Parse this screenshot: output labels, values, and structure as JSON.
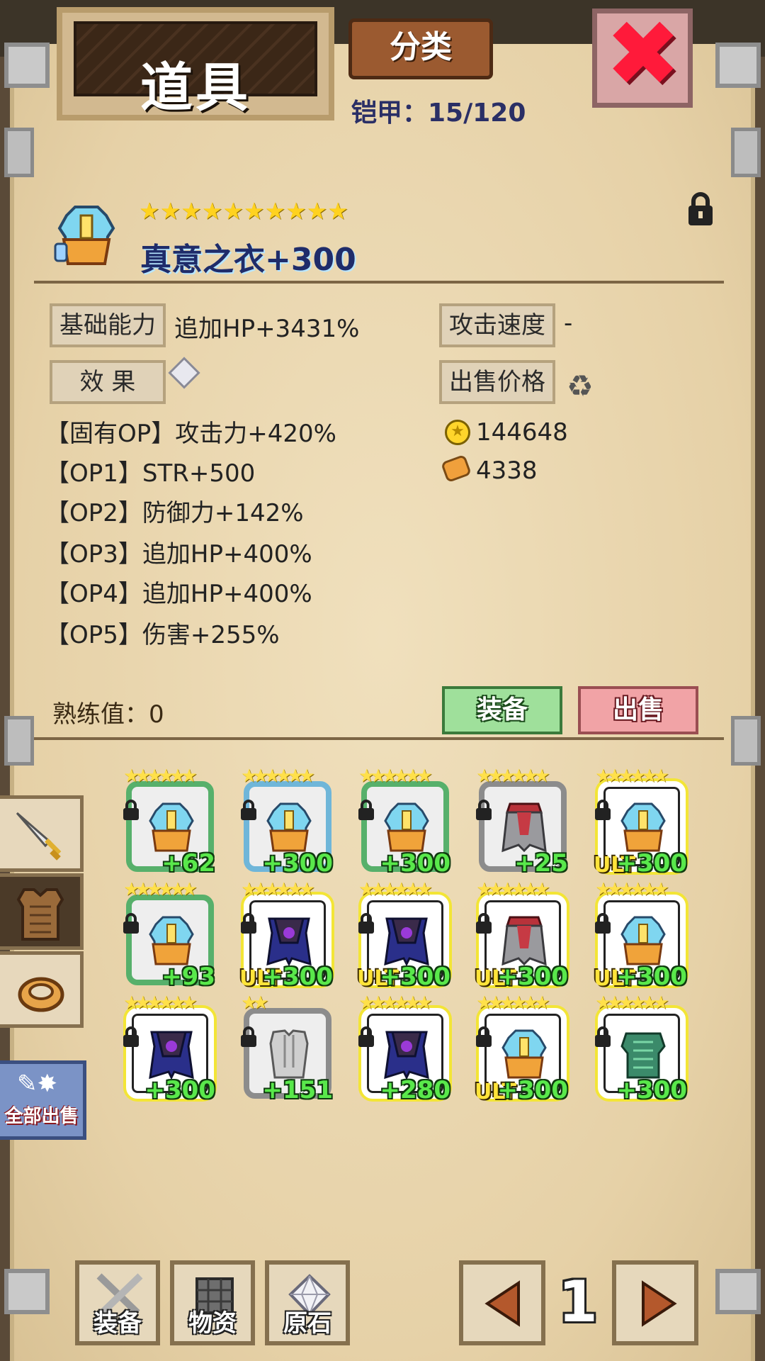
{
  "header": {
    "title": "道具",
    "category_label": "分类",
    "armor_counter": "铠甲：15/120",
    "close_icon": "close-x-icon"
  },
  "item": {
    "stars": "★★★★★★★★★★",
    "name": "真意之衣+300",
    "lock_icon": "lock-icon",
    "base_label": "基础能力",
    "base_value": "追加HP+3431%",
    "effect_label": "效 果",
    "speed_label": "攻击速度",
    "speed_value": "-",
    "price_label": "出售价格",
    "gold_price": "144648",
    "ore_price": "4338",
    "options": [
      "【固有OP】攻击力+420%",
      "【OP1】STR+500",
      "【OP2】防御力+142%",
      "【OP3】追加HP+400%",
      "【OP4】追加HP+400%",
      "【OP5】伤害+255%"
    ],
    "proficiency": "熟练值：0",
    "equip_label": "装备",
    "sell_label": "出售"
  },
  "side_tabs": {
    "weapon_icon": "sword-icon",
    "armor_icon": "armor-icon",
    "ring_icon": "ring-icon",
    "sell_all_label": "全部出售"
  },
  "inventory": [
    {
      "level": "+62",
      "ult": "",
      "stars": "★★★★★★",
      "art": "robe"
    },
    {
      "level": "+300",
      "ult": "",
      "stars": "★★★★★★",
      "art": "robe"
    },
    {
      "level": "+300",
      "ult": "",
      "stars": "★★★★★★",
      "art": "robe"
    },
    {
      "level": "+25",
      "ult": "",
      "stars": "★★★★★★",
      "art": "cape"
    },
    {
      "level": "+300",
      "ult": "ULT",
      "stars": "★★★★★★",
      "art": "robe"
    },
    {
      "level": "+93",
      "ult": "",
      "stars": "★★★★★★",
      "art": "robe"
    },
    {
      "level": "+300",
      "ult": "ULT",
      "stars": "★★★★★★",
      "art": "dark"
    },
    {
      "level": "+300",
      "ult": "ULT",
      "stars": "★★★★★★",
      "art": "dark"
    },
    {
      "level": "+300",
      "ult": "ULT",
      "stars": "★★★★★★",
      "art": "cape"
    },
    {
      "level": "+300",
      "ult": "ULT",
      "stars": "★★★★★★",
      "art": "robe"
    },
    {
      "level": "+300",
      "ult": "",
      "stars": "★★★★★★",
      "art": "dark"
    },
    {
      "level": "+151",
      "ult": "",
      "stars": "★★",
      "art": "iron"
    },
    {
      "level": "+280",
      "ult": "",
      "stars": "★★★★★★",
      "art": "dark"
    },
    {
      "level": "+300",
      "ult": "ULT",
      "stars": "★★★★★★",
      "art": "robe"
    },
    {
      "level": "+300",
      "ult": "",
      "stars": "★★★★★★",
      "art": "green"
    }
  ],
  "bottom_nav": {
    "equip_label": "装备",
    "materials_label": "物资",
    "ore_label": "原石",
    "page_number": "1"
  },
  "colors": {
    "parchment": "#ebd9b4",
    "title_text": "#1f2c6a",
    "level_green": "#59e84b",
    "ult_yellow": "#ffe43a",
    "equip_green": "#9fe09b",
    "sell_red": "#f1a3a6"
  }
}
